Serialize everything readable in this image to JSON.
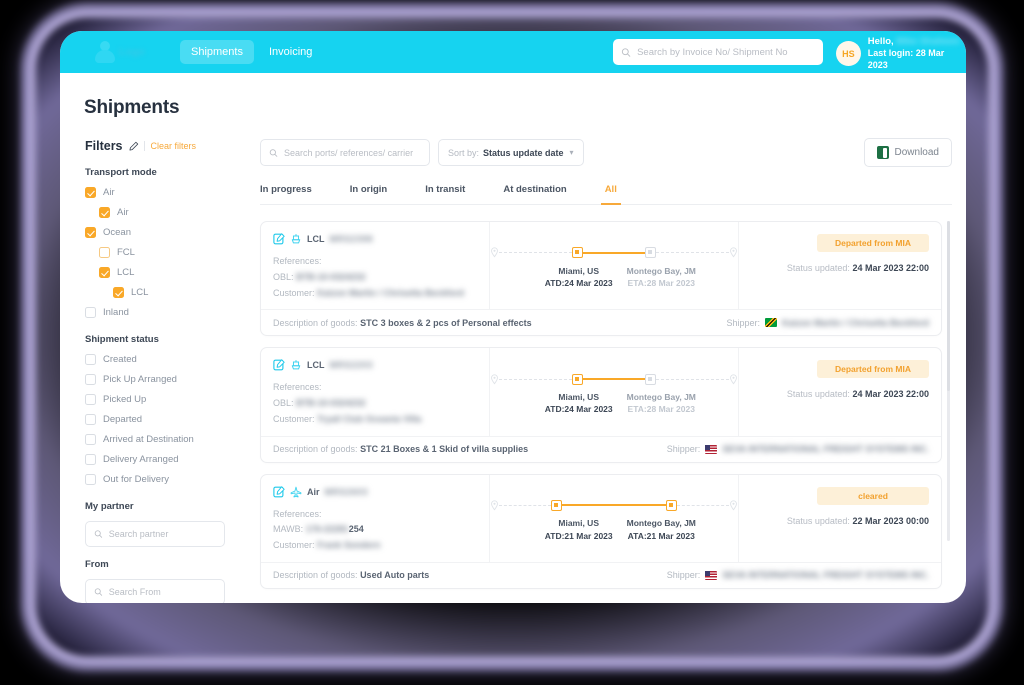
{
  "topnav": {
    "brand": "Logo",
    "tabs": [
      {
        "label": "Shipments",
        "active": true
      },
      {
        "label": "Invoicing",
        "active": false
      }
    ],
    "search_placeholder": "Search by Invoice No/ Shipment No",
    "user": {
      "initials": "HS",
      "greeting": "Hello,",
      "name": "Mike Shaheen",
      "last_login": "Last login: 28 Mar 2023"
    }
  },
  "page": {
    "title": "Shipments"
  },
  "sidebar": {
    "filters_title": "Filters",
    "clear_filters": "Clear filters",
    "sections": [
      {
        "title": "Transport mode",
        "options": [
          {
            "label": "Air",
            "checked": true,
            "indent": 0
          },
          {
            "label": "Air",
            "checked": true,
            "indent": 1
          },
          {
            "label": "Ocean",
            "checked": true,
            "indent": 0
          },
          {
            "label": "FCL",
            "checked": false,
            "indent": 1,
            "outline": true
          },
          {
            "label": "LCL",
            "checked": true,
            "indent": 1
          },
          {
            "label": "LCL",
            "checked": true,
            "indent": 2
          },
          {
            "label": "Inland",
            "checked": false,
            "indent": 0
          }
        ]
      },
      {
        "title": "Shipment status",
        "options": [
          {
            "label": "Created",
            "checked": false,
            "indent": 0
          },
          {
            "label": "Pick Up Arranged",
            "checked": false,
            "indent": 0
          },
          {
            "label": "Picked Up",
            "checked": false,
            "indent": 0
          },
          {
            "label": "Departed",
            "checked": false,
            "indent": 0
          },
          {
            "label": "Arrived at Destination",
            "checked": false,
            "indent": 0
          },
          {
            "label": "Delivery Arranged",
            "checked": false,
            "indent": 0
          },
          {
            "label": "Out for Delivery",
            "checked": false,
            "indent": 0
          }
        ]
      }
    ],
    "partner": {
      "title": "My partner",
      "placeholder": "Search partner",
      "value": ""
    },
    "from": {
      "title": "From",
      "placeholder": "Search From",
      "value": ""
    }
  },
  "toolbar": {
    "search_placeholder": "Search ports/ references/ carrier",
    "search_value": "",
    "sort_label": "Sort by:",
    "sort_value": "Status update date",
    "download_label": "Download"
  },
  "tabs": [
    {
      "label": "In progress",
      "active": false
    },
    {
      "label": "In origin",
      "active": false
    },
    {
      "label": "In transit",
      "active": false
    },
    {
      "label": "At destination",
      "active": false
    },
    {
      "label": "All",
      "active": true
    }
  ],
  "labels": {
    "references": "References:",
    "customer": "Customer:",
    "description": "Description of goods:",
    "shipper": "Shipper:",
    "status_updated": "Status updated:"
  },
  "colors": {
    "brand_cyan": "#16d3f0",
    "accent_orange": "#f9a828",
    "badge_bg": "#fdf0d8",
    "text_dark": "#27313f",
    "text_muted": "#b2b8c0"
  },
  "shipments": [
    {
      "mode": "LCL",
      "mode_icon": "ship-icon",
      "shipment_no": "MRS2398",
      "ref_label": "OBL:",
      "ref_value": "BTB-10-0324232",
      "ref_suffix": "",
      "customer": "Kaizon Martin / Chrisetta Beckford",
      "origin": {
        "city": "Miami, US",
        "date": "ATD:24 Mar 2023",
        "reached": true
      },
      "destination": {
        "city": "Montego Bay, JM",
        "date": "ETA:28 Mar 2023",
        "reached": false
      },
      "status_badge": "Departed from MIA",
      "status_updated": "24 Mar 2023 22:00",
      "description": "STC 3 boxes & 2 pcs of Personal effects",
      "shipper_flag": "jm",
      "shipper_name": "Kaizon Martin / Chrisetta Beckford"
    },
    {
      "mode": "LCL",
      "mode_icon": "ship-icon",
      "shipment_no": "MRS2203",
      "ref_label": "OBL:",
      "ref_value": "BTB-10-0324232",
      "ref_suffix": "",
      "customer": "Tryall Club Oceania Villa",
      "origin": {
        "city": "Miami, US",
        "date": "ATD:24 Mar 2023",
        "reached": true
      },
      "destination": {
        "city": "Montego Bay, JM",
        "date": "ETA:28 Mar 2023",
        "reached": false
      },
      "status_badge": "Departed from MIA",
      "status_updated": "24 Mar 2023 22:00",
      "description": "STC 21 Boxes & 1 Skid of villa supplies",
      "shipper_flag": "us",
      "shipper_name": "SEVA INTERNATIONAL FREIGHT SYSTEMS INC."
    },
    {
      "mode": "Air",
      "mode_icon": "plane-icon",
      "shipment_no": "MRS2603",
      "ref_label": "MAWB:",
      "ref_value": "176-22281",
      "ref_suffix": "254",
      "customer": "Frank Sondern",
      "origin": {
        "city": "Miami, US",
        "date": "ATD:21 Mar 2023",
        "reached": true
      },
      "destination": {
        "city": "Montego Bay, JM",
        "date": "ATA:21 Mar 2023",
        "reached": true
      },
      "status_badge": "cleared",
      "status_updated": "22 Mar 2023 00:00",
      "description": "Used Auto parts",
      "shipper_flag": "us",
      "shipper_name": "SEVA INTERNATIONAL FREIGHT SYSTEMS INC."
    }
  ]
}
